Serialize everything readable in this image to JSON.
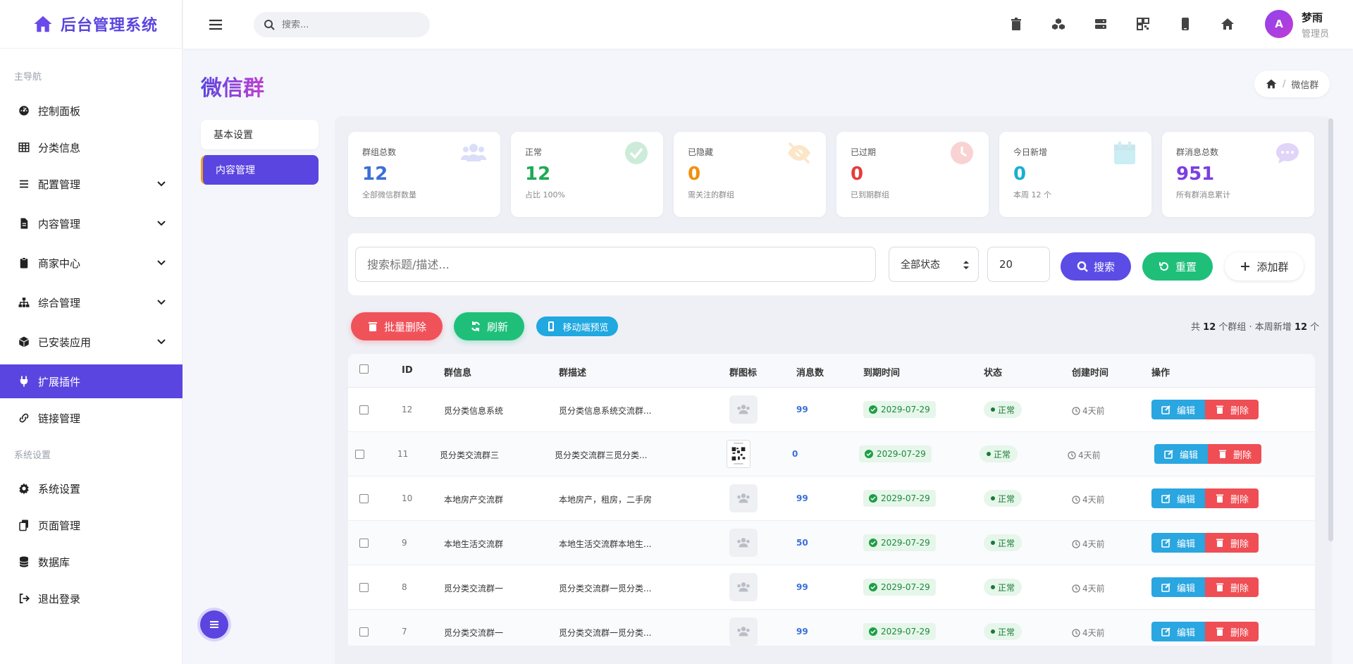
{
  "app": {
    "title": "后台管理系统"
  },
  "sidebar": {
    "main_section": "主导航",
    "system_section": "系统设置",
    "items": [
      {
        "label": "控制面板",
        "icon": "dashboard-icon"
      },
      {
        "label": "分类信息",
        "icon": "table-icon"
      },
      {
        "label": "配置管理",
        "icon": "list-icon"
      },
      {
        "label": "内容管理",
        "icon": "file-icon"
      },
      {
        "label": "商家中心",
        "icon": "clipboard-icon"
      },
      {
        "label": "综合管理",
        "icon": "sitemap-icon"
      },
      {
        "label": "已安装应用",
        "icon": "box-icon"
      },
      {
        "label": "扩展插件",
        "icon": "plug-icon"
      },
      {
        "label": "链接管理",
        "icon": "link-icon"
      }
    ],
    "system_items": [
      {
        "label": "系统设置",
        "icon": "gear-icon"
      },
      {
        "label": "页面管理",
        "icon": "copy-icon"
      },
      {
        "label": "数据库",
        "icon": "database-icon"
      },
      {
        "label": "退出登录",
        "icon": "logout-icon"
      }
    ]
  },
  "topbar": {
    "search_placeholder": "搜索...",
    "user_name": "梦雨",
    "user_role": "管理员",
    "avatar_letter": "A"
  },
  "page": {
    "title": "微信群",
    "breadcrumb": "微信群",
    "subnav": [
      "基本设置",
      "内容管理"
    ]
  },
  "stats": [
    {
      "label": "群组总数",
      "value": "12",
      "sub": "全部微信群数量",
      "color": "#3b6fd8",
      "icon": "users-icon"
    },
    {
      "label": "正常",
      "value": "12",
      "sub": "占比 100%",
      "color": "#1eaa55",
      "icon": "check-circle-icon"
    },
    {
      "label": "已隐藏",
      "value": "0",
      "sub": "需关注的群组",
      "color": "#f0900a",
      "icon": "eye-slash-icon"
    },
    {
      "label": "已过期",
      "value": "0",
      "sub": "已到期群组",
      "color": "#e53d3d",
      "icon": "clock-icon"
    },
    {
      "label": "今日新增",
      "value": "0",
      "sub": "本周 12 个",
      "color": "#19b0d0",
      "icon": "calendar-icon"
    },
    {
      "label": "群消息总数",
      "value": "951",
      "sub": "所有群消息累计",
      "color": "#7b3fe0",
      "icon": "chat-icon"
    }
  ],
  "filters": {
    "search_placeholder": "搜索标题/描述...",
    "status_select": "全部状态",
    "page_size": "20",
    "search_btn": "搜索",
    "reset_btn": "重置",
    "add_btn": "添加群"
  },
  "actions": {
    "batch_delete": "批量删除",
    "refresh": "刷新",
    "mobile_preview": "移动端预览"
  },
  "summary": {
    "prefix": "共",
    "total": "12",
    "mid": "个群组 · 本周新增",
    "week": "12",
    "suffix": "个"
  },
  "table": {
    "headers": [
      "ID",
      "群信息",
      "群描述",
      "群图标",
      "消息数",
      "到期时间",
      "状态",
      "创建时间",
      "操作"
    ],
    "edit_label": "编辑",
    "delete_label": "删除",
    "rows": [
      {
        "id": "12",
        "name": "觅分类信息系统",
        "desc": "觅分类信息系统交流群...",
        "icon": "default",
        "msgs": "99",
        "expire": "2029-07-29",
        "status": "正常",
        "created": "4天前"
      },
      {
        "id": "11",
        "name": "觅分类交流群三",
        "desc": "觅分类交流群三觅分类...",
        "icon": "qr",
        "msgs": "0",
        "expire": "2029-07-29",
        "status": "正常",
        "created": "4天前"
      },
      {
        "id": "10",
        "name": "本地房产交流群",
        "desc": "本地房产，租房，二手房",
        "icon": "default",
        "msgs": "99",
        "expire": "2029-07-29",
        "status": "正常",
        "created": "4天前"
      },
      {
        "id": "9",
        "name": "本地生活交流群",
        "desc": "本地生活交流群本地生...",
        "icon": "default",
        "msgs": "50",
        "expire": "2029-07-29",
        "status": "正常",
        "created": "4天前"
      },
      {
        "id": "8",
        "name": "觅分类交流群一",
        "desc": "觅分类交流群一觅分类...",
        "icon": "default",
        "msgs": "99",
        "expire": "2029-07-29",
        "status": "正常",
        "created": "4天前"
      },
      {
        "id": "7",
        "name": "觅分类交流群一",
        "desc": "觅分类交流群一觅分类...",
        "icon": "default",
        "msgs": "99",
        "expire": "2029-07-29",
        "status": "正常",
        "created": "4天前"
      }
    ]
  }
}
